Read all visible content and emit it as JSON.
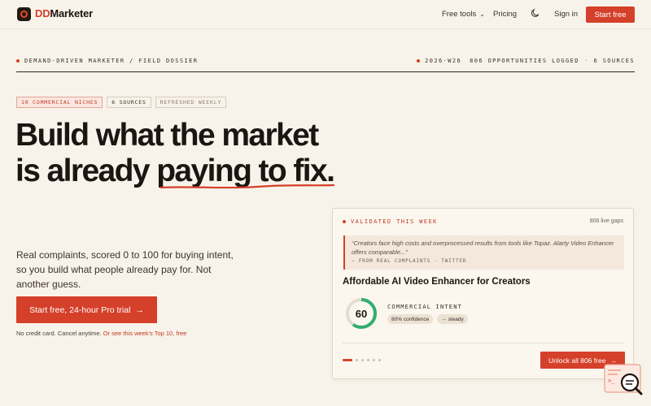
{
  "nav": {
    "brand_prefix": "DD",
    "brand_suffix": "Marketer",
    "free_tools": "Free tools",
    "pricing": "Pricing",
    "sign_in": "Sign in",
    "start_free": "Start free"
  },
  "dossier": {
    "left": "DEMAND-DRIVEN MARKETER / FIELD DOSSIER",
    "week": "2026·W26",
    "logged": "806 OPPORTUNITIES LOGGED",
    "sep": "·",
    "sources": "6 SOURCES"
  },
  "chips": [
    "10 COMMERCIAL NICHES",
    "6 SOURCES",
    "REFRESHED WEEKLY"
  ],
  "hero": {
    "line1": "Build what the market",
    "line2_a": "is already ",
    "line2_b": "paying to fix.",
    "lede": "Real complaints, scored 0 to 100 for buying intent, so you build what people already pay for. Not another guess.",
    "cta": "Start free, 24-hour Pro trial",
    "cta_arrow": "→",
    "fine_a": "No credit card. Cancel anytime. ",
    "fine_link": "Or see this week's Top 10, free"
  },
  "card": {
    "head": "VALIDATED THIS WEEK",
    "live": "806 live gaps",
    "quote": "“Creators face high costs and overprocessed results from tools like Topaz. Alarty Video Enhancer offers comparable...”",
    "quote_src": "— FROM REAL COMPLAINTS · TWITTER",
    "title": "Affordable AI Video Enhancer for Creators",
    "score": "60",
    "score_value": 60,
    "intent_label": "COMMERCIAL INTENT",
    "confidence": "80% confidence",
    "trend": "→ steady",
    "unlock": "Unlock all 806 free",
    "unlock_arrow": "→"
  },
  "colors": {
    "accent": "#d5402a",
    "score_ring": "#2fae6e",
    "background": "#f8f3ea"
  }
}
